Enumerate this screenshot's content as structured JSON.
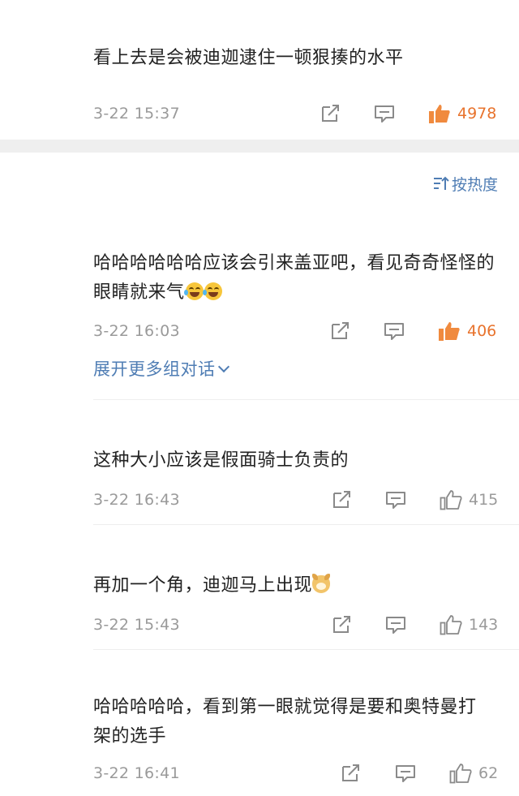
{
  "comments": [
    {
      "text": "看上去是会被迪迦逮住一顿狠揍的水平",
      "time": "3-22 15:37",
      "likes": "4978",
      "liked": true
    },
    {
      "text": "哈哈哈哈哈哈应该会引来盖亚吧，看见奇奇怪怪的眼睛就来气",
      "time": "3-22 16:03",
      "likes": "406",
      "liked": true
    },
    {
      "text": "这种大小应该是假面骑士负责的",
      "time": "3-22 16:43",
      "likes": "415",
      "liked": false
    },
    {
      "text": "再加一个角，迪迦马上出现",
      "time": "3-22 15:43",
      "likes": "143",
      "liked": false
    },
    {
      "text": "哈哈哈哈哈，看到第一眼就觉得是要和奥特曼打架的选手",
      "time": "3-22 16:41",
      "likes": "62",
      "liked": false
    }
  ],
  "sort_label": "按热度",
  "expand_label": "展开更多组对话",
  "colors": {
    "link": "#4f7db4",
    "liked": "#e8732d",
    "meta": "#9a9a9a"
  },
  "icons": [
    "share-icon",
    "comment-icon",
    "thumbs-up-icon",
    "sort-icon",
    "chevron-down-icon",
    "laugh-tears-emoji",
    "doge-emoji"
  ]
}
